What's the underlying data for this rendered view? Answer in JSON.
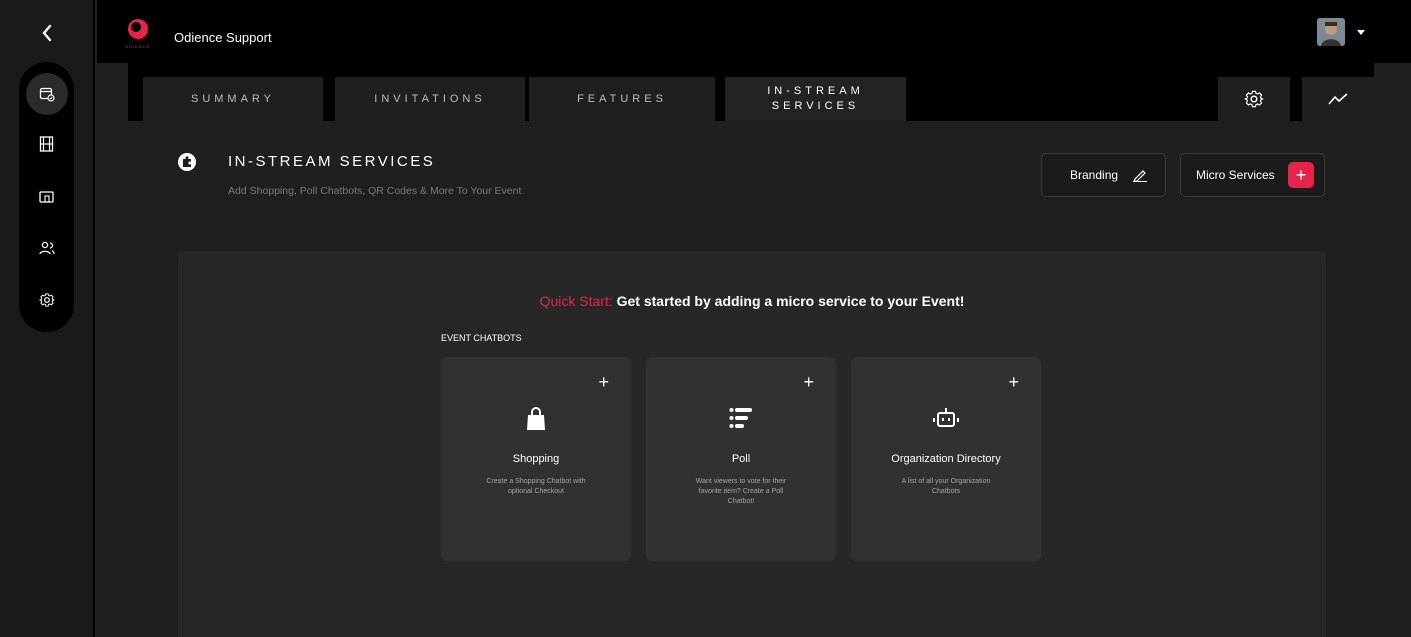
{
  "header": {
    "org_name": "Odience Support",
    "logo_text": "ODIENCE"
  },
  "sidebar": {
    "items": [
      {
        "icon": "calendar-check-icon"
      },
      {
        "icon": "film-icon"
      },
      {
        "icon": "devices-icon"
      },
      {
        "icon": "users-icon"
      },
      {
        "icon": "gear-icon"
      }
    ]
  },
  "tabs": [
    {
      "label": "SUMMARY"
    },
    {
      "label": "INVITATIONS"
    },
    {
      "label": "FEATURES"
    },
    {
      "label": "IN-STREAM SERVICES",
      "line1": "IN-STREAM",
      "line2": "SERVICES",
      "active": true
    }
  ],
  "page": {
    "title": "IN-STREAM SERVICES",
    "subtitle": "Add Shopping, Poll Chatbots, QR Codes & More To Your Event",
    "branding_label": "Branding",
    "micro_label": "Micro Services"
  },
  "quick_start": {
    "prefix": "Quick Start:",
    "text": " Get started by adding a micro service to your Event!"
  },
  "section_label": "EVENT CHATBOTS",
  "cards": [
    {
      "title": "Shopping",
      "desc": "Create a Shopping Chatbot with optional Checkout",
      "icon": "shopping-bag-icon"
    },
    {
      "title": "Poll",
      "desc": "Want viewers to vote for their favorite item? Create a Poll Chatbot!",
      "icon": "poll-list-icon"
    },
    {
      "title": "Organization Directory",
      "desc": "A list of all your Organization Chatbots",
      "icon": "robot-icon"
    }
  ],
  "colors": {
    "accent": "#e8234a",
    "background": "#1f1f1f",
    "panel": "#272727",
    "card": "#313131"
  }
}
